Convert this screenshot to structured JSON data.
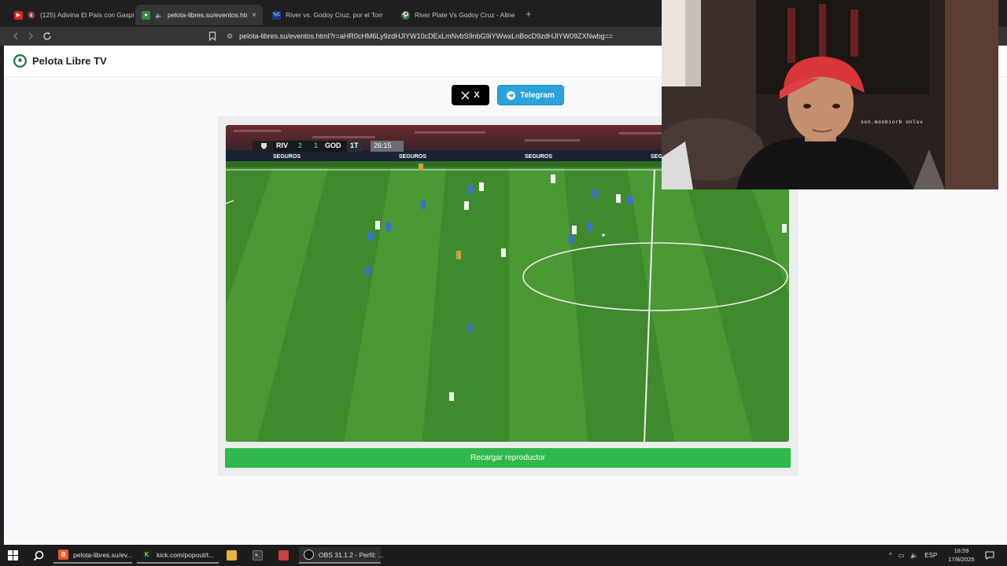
{
  "browser": {
    "tabs": [
      {
        "label": "(125) Adivina El País con Gaspi -",
        "favicon": "youtube-icon",
        "muted": true
      },
      {
        "label": "pelota-libres.su/eventos.html",
        "favicon": "pelota-libre-icon",
        "active": true,
        "close": "×"
      },
      {
        "label": "River vs. Godoy Cruz, por el Torneo",
        "favicon": "tyc-icon",
        "badge": "TyC"
      },
      {
        "label": "River Plate Vs Godoy Cruz - Alineació",
        "favicon": "soccer-ball-icon"
      }
    ],
    "new_tab": "+",
    "url": "pelota-libres.su/eventos.html?r=aHR0cHM6Ly9zdHJlYW10cDExLmNvbS9nbG9iYWwxLnBocD9zdHJlYW09ZXNwbg=="
  },
  "page": {
    "brand": "Pelota Libre TV",
    "share_x_label": "X",
    "share_telegram_label": "Telegram",
    "reload_label": "Recargar reproductor"
  },
  "video": {
    "home_team": "RIV",
    "home_score": "2",
    "away_score": "1",
    "away_team": "GOD",
    "period": "1T",
    "clock": "26:15",
    "sponsor": "SEGUROS"
  },
  "webcam": {
    "overlay_text": "son.mosbiorb onlsv"
  },
  "taskbar": {
    "items": [
      {
        "label": "pelota-libres.su/ev...",
        "icon": "brave-icon"
      },
      {
        "label": "kick.com/popout/t...",
        "icon": "kick-icon"
      },
      {
        "label": "",
        "icon": "folder-icon"
      },
      {
        "label": "",
        "icon": "terminal-icon"
      },
      {
        "label": "",
        "icon": "app-icon"
      },
      {
        "label": "OBS 31.1.2 - Perfil: ...",
        "icon": "obs-icon"
      }
    ],
    "language": "ESP",
    "time": "18:59",
    "date": "17/8/2025"
  },
  "colors": {
    "telegram": "#2aa3dc",
    "reload_green": "#2fb84b",
    "pitch_green": "#3f8a2c"
  }
}
